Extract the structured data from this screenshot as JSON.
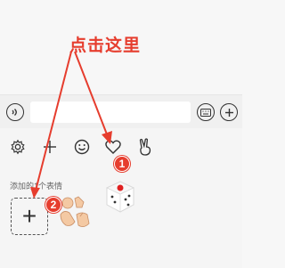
{
  "annotation": {
    "text": "点击这里",
    "marker1": "1",
    "marker2": "2"
  },
  "emoji_panel": {
    "section_title": "添加的1个表情"
  },
  "tabs": [
    "settings-icon",
    "add-icon",
    "smile-icon",
    "heart-icon",
    "victory-hand-icon"
  ],
  "colors": {
    "annotation_red": "#e63d2e",
    "background": "#f5f5f5"
  }
}
